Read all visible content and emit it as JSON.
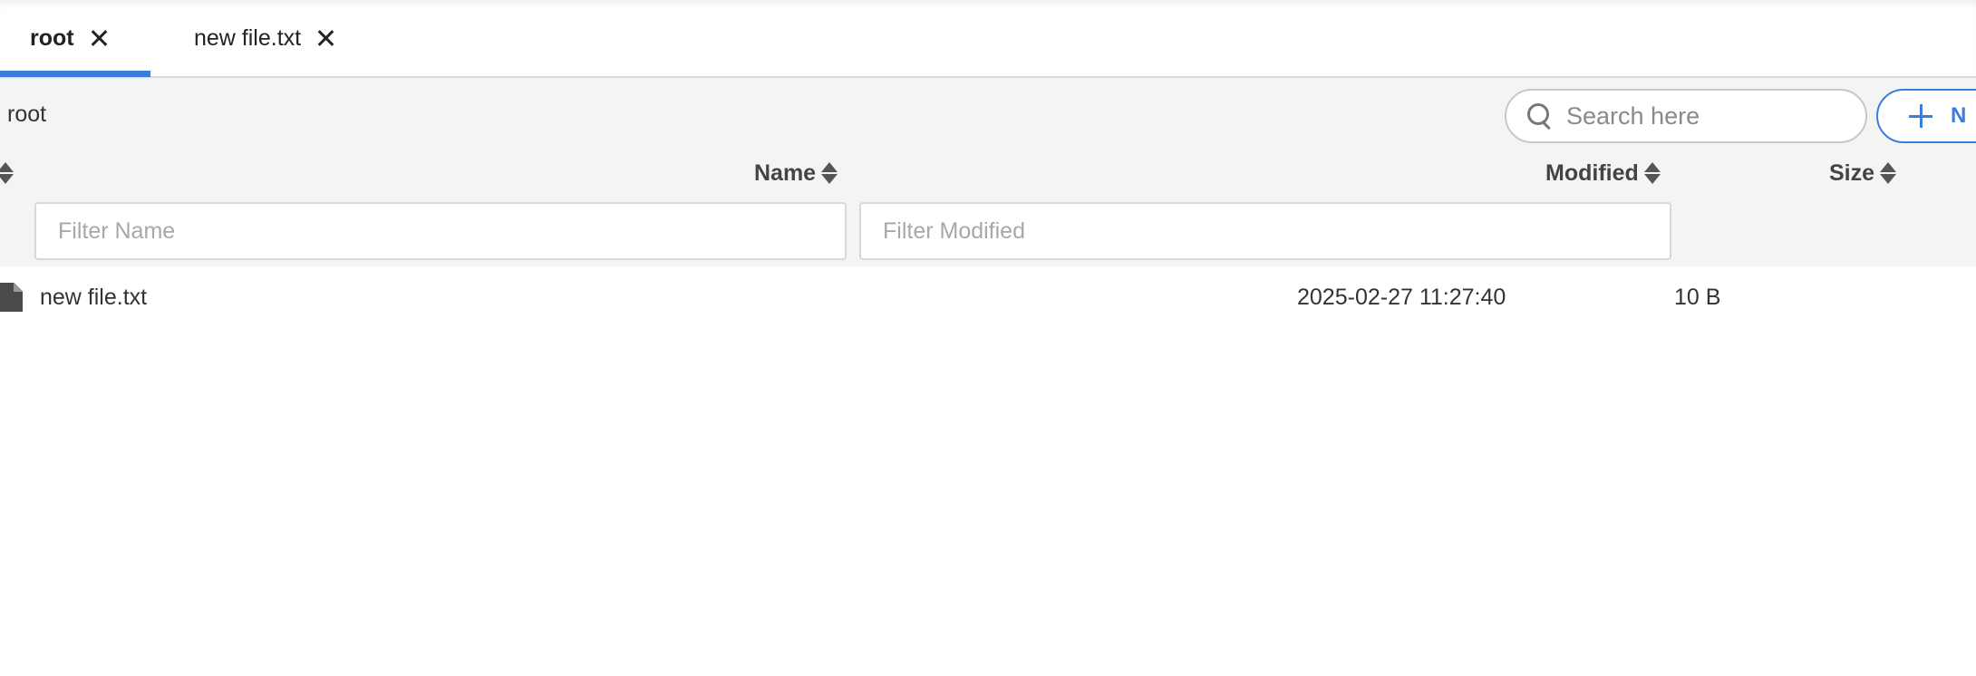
{
  "tabs": [
    {
      "label": "root",
      "active": true
    },
    {
      "label": "new file.txt",
      "active": false
    }
  ],
  "breadcrumb": "root",
  "search": {
    "placeholder": "Search here",
    "value": ""
  },
  "new_button": {
    "label": "N"
  },
  "columns": {
    "name": "Name",
    "modified": "Modified",
    "size": "Size"
  },
  "filters": {
    "name_placeholder": "Filter Name",
    "modified_placeholder": "Filter Modified"
  },
  "rows": [
    {
      "name": "new file.txt",
      "modified": "2025-02-27 11:27:40",
      "size": "10 B",
      "icon": "file-icon"
    }
  ],
  "colors": {
    "accent": "#3b7ddd",
    "header_bg": "#f4f4f4"
  }
}
